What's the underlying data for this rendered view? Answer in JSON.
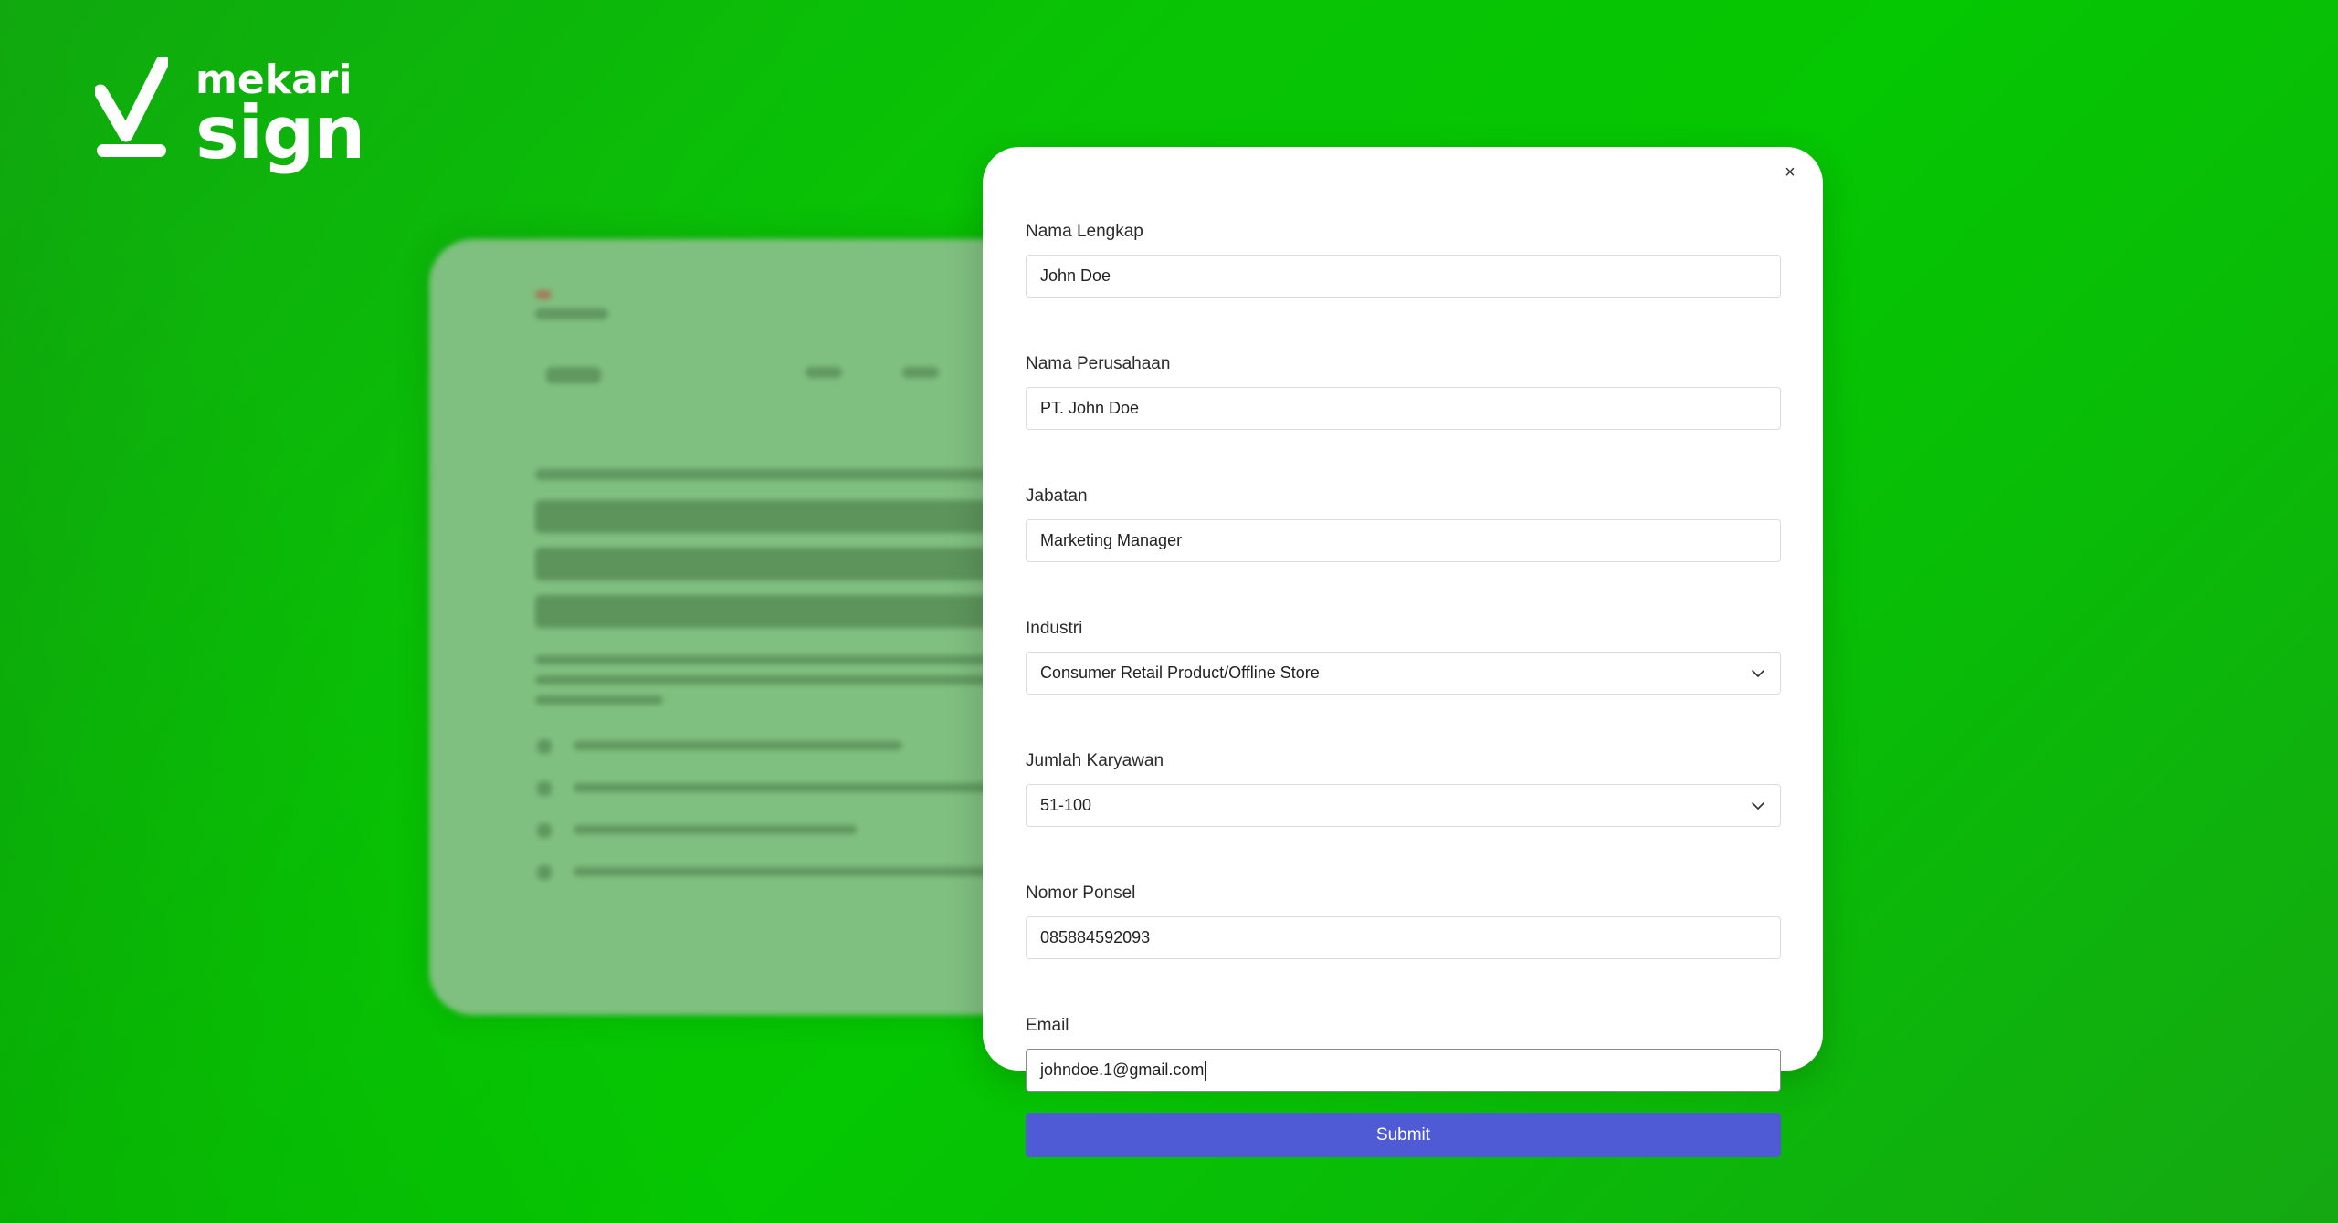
{
  "brand": {
    "name_top": "mekari",
    "name_bottom": "sign"
  },
  "modal": {
    "close_label": "×",
    "fields": [
      {
        "label": "Nama Lengkap",
        "value": "John Doe"
      },
      {
        "label": "Nama Perusahaan",
        "value": "PT. John Doe"
      },
      {
        "label": "Jabatan",
        "value": "Marketing Manager"
      },
      {
        "label": "Industri",
        "value": "Consumer Retail Product/Offline Store"
      },
      {
        "label": "Jumlah Karyawan",
        "value": "51-100"
      },
      {
        "label": "Nomor Ponsel",
        "value": "085884592093"
      },
      {
        "label": "Email",
        "value": "johndoe.1@gmail.com"
      }
    ],
    "submit_label": "Submit"
  },
  "colors": {
    "background": "#05c702",
    "submit_button": "#4f5bd5",
    "modal": "#ffffff"
  }
}
